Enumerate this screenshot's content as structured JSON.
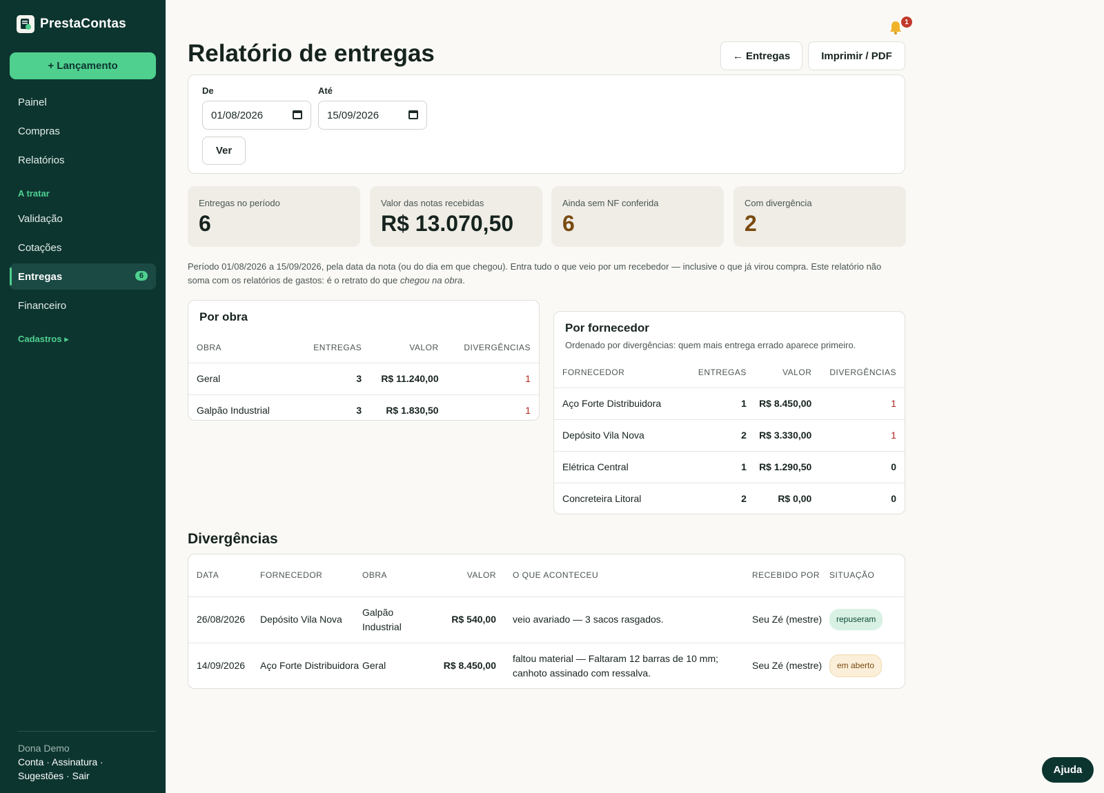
{
  "app": {
    "name": "PrestaContas",
    "new_button": "+ Lançamento"
  },
  "nav": {
    "items": [
      "Painel",
      "Compras",
      "Relatórios"
    ],
    "section_to_treat": "A tratar",
    "treat_items": [
      "Validação",
      "Cotações",
      "Entregas",
      "Financeiro"
    ],
    "entregas_badge": "6",
    "section_registry": "Cadastros ▸"
  },
  "footer": {
    "user": "Dona Demo",
    "links_line1": "Conta · Assinatura ·",
    "links_line2": "Sugestões · Sair"
  },
  "notifications": {
    "count": "1",
    "icon": "bell-icon"
  },
  "header": {
    "title": "Relatório de entregas",
    "back_button": "← Entregas",
    "print_button": "Imprimir / PDF"
  },
  "filter": {
    "from_label": "De",
    "from_value": "01/08/2026",
    "to_label": "Até",
    "to_value": "15/09/2026",
    "submit": "Ver"
  },
  "stats": [
    {
      "label": "Entregas no período",
      "value": "6"
    },
    {
      "label": "Valor das notas recebidas",
      "value": "R$ 13.070,50"
    },
    {
      "label": "Ainda sem NF conferida",
      "value": "6"
    },
    {
      "label": "Com divergência",
      "value": "2"
    }
  ],
  "note": {
    "text": "Período 01/08/2026 a 15/09/2026, pela data da nota (ou do dia em que chegou). Entra tudo o que veio por um recebedor — inclusive o que já virou compra. Este relatório não soma com os relatórios de gastos: é o retrato do que ",
    "emphasis": "chegou na obra",
    "end": "."
  },
  "by_site": {
    "title": "Por obra",
    "columns": [
      "OBRA",
      "ENTREGAS",
      "VALOR",
      "DIVERGÊNCIAS"
    ],
    "rows": [
      [
        "Geral",
        "3",
        "R$ 11.240,00",
        "1"
      ],
      [
        "Galpão Industrial",
        "3",
        "R$ 1.830,50",
        "1"
      ]
    ]
  },
  "by_supplier": {
    "title": "Por fornecedor",
    "subtitle": "Ordenado por divergências: quem mais entrega errado aparece primeiro.",
    "columns": [
      "FORNECEDOR",
      "ENTREGAS",
      "VALOR",
      "DIVERGÊNCIAS"
    ],
    "rows": [
      [
        "Aço Forte Distribuidora",
        "1",
        "R$ 8.450,00",
        "1"
      ],
      [
        "Depósito Vila Nova",
        "2",
        "R$ 3.330,00",
        "1"
      ],
      [
        "Elétrica Central",
        "1",
        "R$ 1.290,50",
        "0"
      ],
      [
        "Concreteira Litoral",
        "2",
        "R$ 0,00",
        "0"
      ]
    ]
  },
  "divergences": {
    "title": "Divergências",
    "columns": [
      "DATA",
      "FORNECEDOR",
      "OBRA",
      "VALOR",
      "O QUE ACONTECEU",
      "RECEBIDO POR",
      "SITUAÇÃO"
    ],
    "rows": [
      [
        "26/08/2026",
        "Depósito Vila Nova",
        "Galpão Industrial",
        "R$ 540,00",
        "veio avariado — 3 sacos rasgados.",
        "Seu Zé (mestre)",
        "repuseram"
      ],
      [
        "14/09/2026",
        "Aço Forte Distribuidora",
        "Geral",
        "R$ 8.450,00",
        "faltou material — Faltaram 12 barras de 10 mm; canhoto assinado com ressalva.",
        "Seu Zé (mestre)",
        "em aberto"
      ]
    ]
  },
  "help": "Ajuda"
}
